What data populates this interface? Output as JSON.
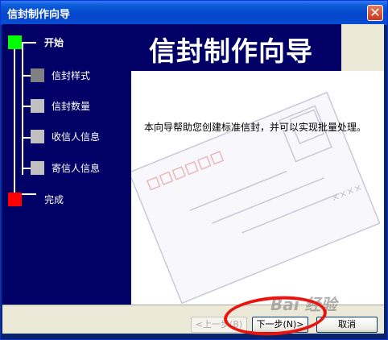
{
  "window": {
    "title": "信封制作向导",
    "close_symbol": "✕"
  },
  "banner": {
    "title": "信封制作向导"
  },
  "steps": [
    {
      "label": "开始",
      "color": "#00ff00",
      "kind": "endpoint"
    },
    {
      "label": "信封样式",
      "color": "#808080",
      "kind": "step"
    },
    {
      "label": "信封数量",
      "color": "#c0c0c0",
      "kind": "step"
    },
    {
      "label": "收信人信息",
      "color": "#c0c0c0",
      "kind": "step"
    },
    {
      "label": "寄信人信息",
      "color": "#c0c0c0",
      "kind": "step"
    },
    {
      "label": "完成",
      "color": "#ff0000",
      "kind": "endpoint"
    }
  ],
  "main": {
    "intro_text": "本向导帮助您创建标准信封，并可以实现批量处理。",
    "envelope_mark": "××××"
  },
  "buttons": {
    "prev": "<上一步(B)",
    "next": "下一步(N)>",
    "cancel": "取消"
  },
  "watermark": {
    "text": "Bai 经验"
  },
  "colors": {
    "highlight": "#e8150e",
    "panel": "#000066"
  }
}
